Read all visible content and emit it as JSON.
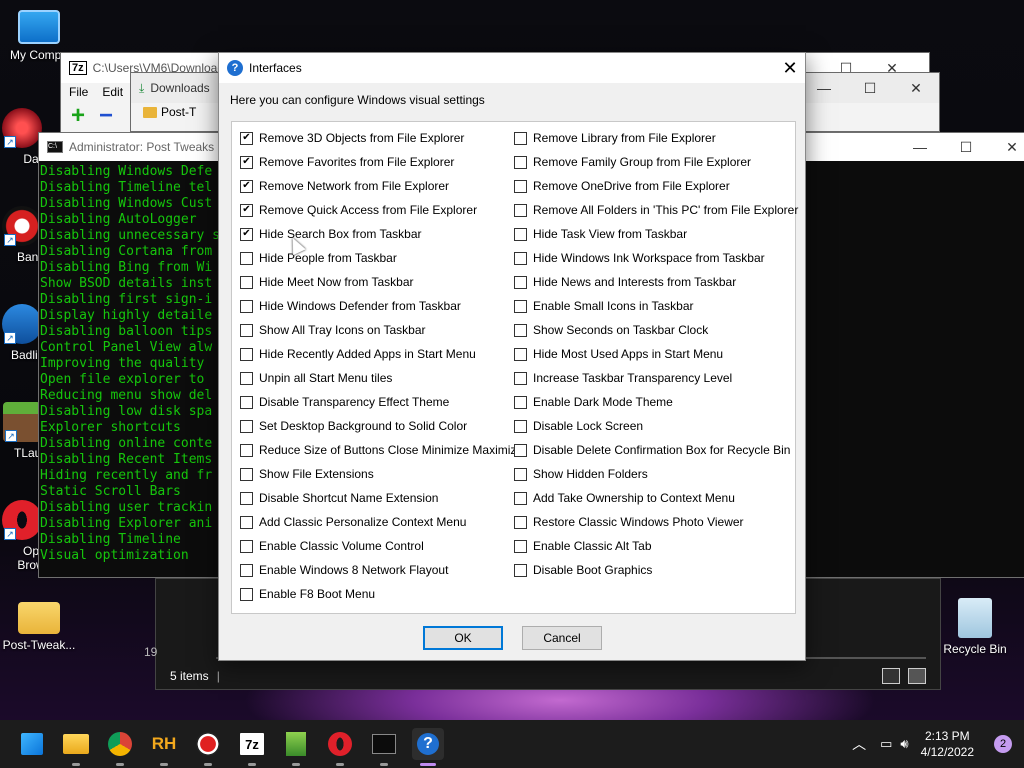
{
  "desktop": {
    "icons": [
      {
        "label": "My Compu",
        "icon": "monitor-icon"
      },
      {
        "label": "DataW",
        "icon": "datawarp-icon"
      },
      {
        "label": "Band",
        "icon": "bandicam-icon"
      },
      {
        "label": "Badlion",
        "icon": "badlion-icon"
      },
      {
        "label": "TLaun",
        "icon": "tlauncher-icon"
      },
      {
        "label": "Op",
        "label2": "Brow",
        "icon": "opera-icon"
      },
      {
        "label": "Post-Tweak...",
        "icon": "folder-icon"
      },
      {
        "label": "Recycle Bin",
        "icon": "recycle-bin-icon"
      }
    ]
  },
  "windows": {
    "sevenzip": {
      "title": "C:\\Users\\VM6\\Download",
      "menu": [
        "File",
        "Edit"
      ]
    },
    "downloads": {
      "title": "Downloads",
      "folder": "Post-T"
    },
    "console": {
      "title": "Administrator: Post Tweaks",
      "lines": [
        "Disabling Windows Defe",
        "Disabling Timeline tel",
        "Disabling Windows Cust",
        "Disabling AutoLogger",
        "Disabling unnecessary s",
        "Disabling Cortana from",
        "Disabling Bing from Wi",
        "Show BSOD details inst",
        "Disabling first sign-i",
        "Display highly detaile",
        "Disabling balloon tips",
        "Control Panel View alw",
        "Improving the quality",
        "Open file explorer to",
        "Reducing menu show del",
        "Disabling low disk spa",
        "Explorer shortcuts",
        "Disabling online conte",
        "Disabling Recent Items",
        "Hiding recently and fr",
        "Static Scroll Bars",
        "Disabling user trackin",
        "Disabling Explorer ani",
        "Disabling Timeline",
        "Visual optimization"
      ]
    },
    "explorer": {
      "status": "5 items",
      "partial": "19"
    }
  },
  "dialog": {
    "title": "Interfaces",
    "intro": "Here you can configure Windows visual settings",
    "left_options": [
      {
        "label": "Remove 3D Objects from File Explorer",
        "checked": true
      },
      {
        "label": "Remove Favorites from File Explorer",
        "checked": true
      },
      {
        "label": "Remove Network from File Explorer",
        "checked": true
      },
      {
        "label": "Remove Quick Access from File Explorer",
        "checked": true
      },
      {
        "label": "Hide Search Box from Taskbar",
        "checked": true
      },
      {
        "label": "Hide People from Taskbar",
        "checked": false
      },
      {
        "label": "Hide Meet Now from Taskbar",
        "checked": false
      },
      {
        "label": "Hide Windows Defender from Taskbar",
        "checked": false
      },
      {
        "label": "Show All Tray Icons on Taskbar",
        "checked": false
      },
      {
        "label": "Hide Recently Added Apps in Start Menu",
        "checked": false
      },
      {
        "label": "Unpin all Start Menu tiles",
        "checked": false
      },
      {
        "label": "Disable Transparency Effect Theme",
        "checked": false
      },
      {
        "label": "Set Desktop Background to Solid Color",
        "checked": false
      },
      {
        "label": "Reduce Size of Buttons Close Minimize Maximize",
        "checked": false
      },
      {
        "label": "Show File Extensions",
        "checked": false
      },
      {
        "label": "Disable Shortcut Name Extension",
        "checked": false
      },
      {
        "label": "Add Classic Personalize Context Menu",
        "checked": false
      },
      {
        "label": "Enable Classic Volume Control",
        "checked": false
      },
      {
        "label": "Enable Windows 8 Network Flayout",
        "checked": false
      },
      {
        "label": "Enable F8 Boot Menu",
        "checked": false
      }
    ],
    "right_options": [
      {
        "label": "Remove Library from File Explorer",
        "checked": false
      },
      {
        "label": "Remove Family Group from File Explorer",
        "checked": false
      },
      {
        "label": "Remove OneDrive from File Explorer",
        "checked": false
      },
      {
        "label": "Remove All Folders in 'This PC' from File Explorer",
        "checked": false
      },
      {
        "label": "Hide Task View from Taskbar",
        "checked": false
      },
      {
        "label": "Hide Windows Ink Workspace from Taskbar",
        "checked": false
      },
      {
        "label": "Hide News and Interests from Taskbar",
        "checked": false
      },
      {
        "label": "Enable Small Icons in Taskbar",
        "checked": false
      },
      {
        "label": "Show Seconds on Taskbar Clock",
        "checked": false
      },
      {
        "label": "Hide Most Used Apps in Start Menu",
        "checked": false
      },
      {
        "label": "Increase Taskbar Transparency Level",
        "checked": false
      },
      {
        "label": "Enable Dark Mode Theme",
        "checked": false
      },
      {
        "label": "Disable Lock Screen",
        "checked": false
      },
      {
        "label": "Disable Delete Confirmation Box for Recycle Bin",
        "checked": false
      },
      {
        "label": "Show Hidden Folders",
        "checked": false
      },
      {
        "label": "Add Take Ownership to Context Menu",
        "checked": false
      },
      {
        "label": "Restore Classic Windows Photo Viewer",
        "checked": false
      },
      {
        "label": "Enable Classic Alt Tab",
        "checked": false
      },
      {
        "label": "Disable Boot Graphics",
        "checked": false
      }
    ],
    "ok_label": "OK",
    "cancel_label": "Cancel"
  },
  "taskbar": {
    "apps": [
      {
        "name": "start-icon",
        "glyph": ""
      },
      {
        "name": "file-explorer-icon",
        "glyph": ""
      },
      {
        "name": "chrome-icon",
        "glyph": ""
      },
      {
        "name": "revo-uninstaller-icon",
        "glyph": "RH"
      },
      {
        "name": "record-icon",
        "glyph": ""
      },
      {
        "name": "7zip-icon",
        "glyph": "7z"
      },
      {
        "name": "notepad-icon",
        "glyph": ""
      },
      {
        "name": "opera-icon",
        "glyph": ""
      },
      {
        "name": "terminal-icon",
        "glyph": ""
      },
      {
        "name": "help-icon",
        "glyph": "?"
      }
    ],
    "time": "2:13 PM",
    "date": "4/12/2022",
    "notifications": "2"
  },
  "colors": {
    "accent": "#0078d7",
    "console_text": "#16c60c",
    "taskbar": "#1c1c1c"
  }
}
